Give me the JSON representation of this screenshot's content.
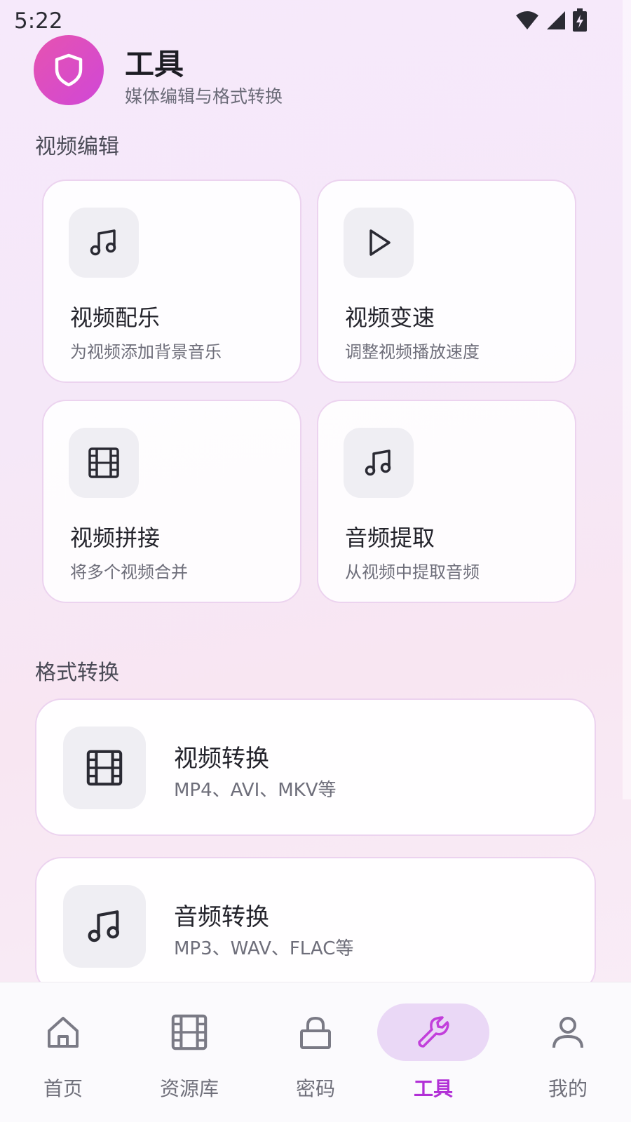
{
  "status_bar": {
    "time": "5:22"
  },
  "header": {
    "title": "工具",
    "subtitle": "媒体编辑与格式转换"
  },
  "sections": {
    "video_edit": {
      "title": "视频编辑",
      "cards": [
        {
          "title": "视频配乐",
          "desc": "为视频添加背景音乐",
          "icon": "music-icon"
        },
        {
          "title": "视频变速",
          "desc": "调整视频播放速度",
          "icon": "play-icon"
        },
        {
          "title": "视频拼接",
          "desc": "将多个视频合并",
          "icon": "film-icon"
        },
        {
          "title": "音频提取",
          "desc": "从视频中提取音频",
          "icon": "music-icon"
        }
      ]
    },
    "format_convert": {
      "title": "格式转换",
      "cards": [
        {
          "title": "视频转换",
          "desc": "MP4、AVI、MKV等",
          "icon": "film-icon"
        },
        {
          "title": "音频转换",
          "desc": "MP3、WAV、FLAC等",
          "icon": "music-icon"
        }
      ]
    }
  },
  "nav": {
    "items": [
      {
        "label": "首页",
        "icon": "home-icon"
      },
      {
        "label": "资源库",
        "icon": "film-icon"
      },
      {
        "label": "密码",
        "icon": "lock-icon"
      },
      {
        "label": "工具",
        "icon": "wrench-icon",
        "active": true
      },
      {
        "label": "我的",
        "icon": "user-icon"
      }
    ]
  },
  "colors": {
    "accent": "#b12fd6",
    "logo_start": "#e653b0",
    "logo_end": "#d047d7",
    "card_border": "#ecd3ef",
    "icon_box_bg": "#efeef3"
  }
}
